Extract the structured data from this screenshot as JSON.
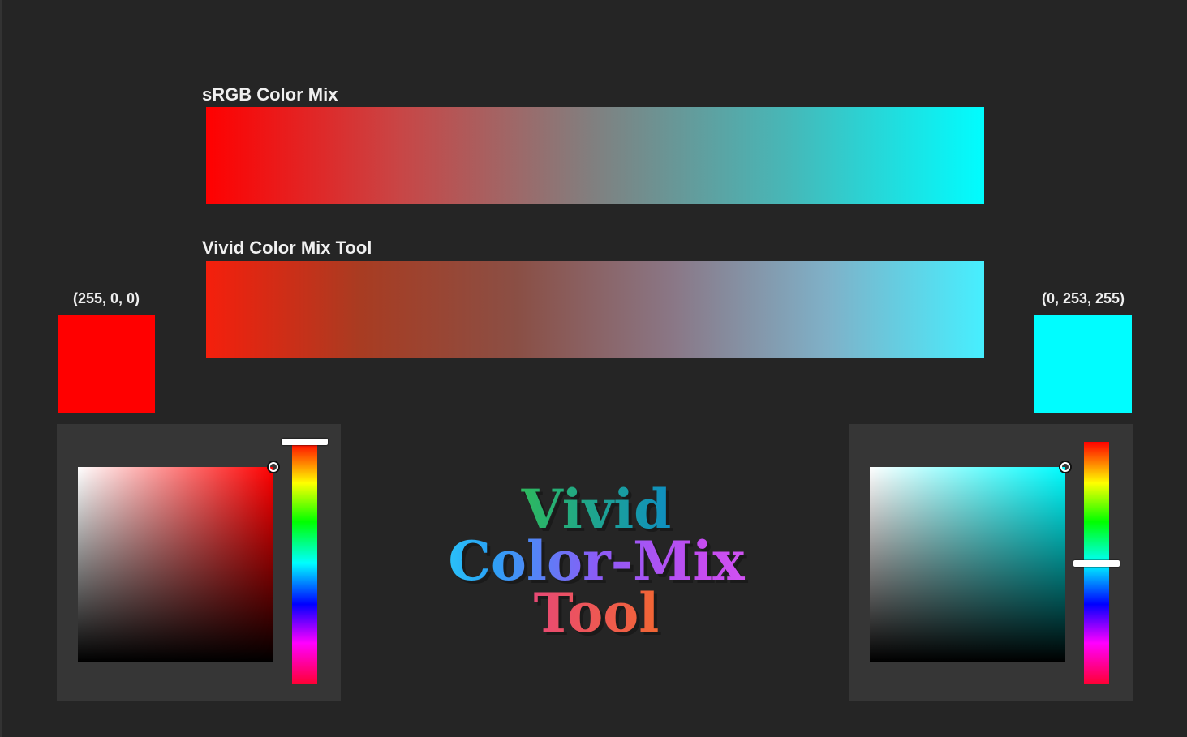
{
  "srgb_mix": {
    "title": "sRGB Color Mix",
    "gradient_stops": [
      "#ff0000",
      "#c84646",
      "#808080",
      "#46b8b8",
      "#00fdff"
    ]
  },
  "vivid_mix": {
    "title": "Vivid Color Mix Tool",
    "gradient_stops": [
      "#f51f0c",
      "#a83c22",
      "#8a4f45",
      "#8a7786",
      "#7fb1c8",
      "#46efff"
    ]
  },
  "left_color": {
    "rgb_label": "(255, 0, 0)",
    "hex": "#ff0000",
    "hue_hex": "#ff0000",
    "saturation": 1.0,
    "value": 1.0,
    "hue_fraction": 0.0
  },
  "right_color": {
    "rgb_label": "(0, 253, 255)",
    "hex": "#00fdff",
    "hue_hex": "#00fdff",
    "saturation": 1.0,
    "value": 1.0,
    "hue_fraction": 0.5
  },
  "logo": {
    "line1": "Vivid",
    "line2": "Color-Mix",
    "line3": "Tool"
  },
  "colors": {
    "background": "#252525",
    "panel": "#363636",
    "text": "#f0f0f0"
  }
}
